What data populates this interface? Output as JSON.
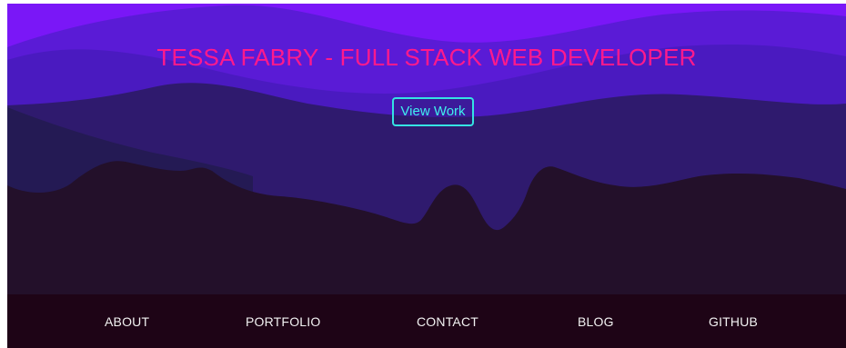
{
  "hero": {
    "title": "TESSA FABRY - FULL STACK WEB DEVELOPER",
    "cta_label": "View Work"
  },
  "nav": {
    "items": [
      {
        "label": "ABOUT"
      },
      {
        "label": "PORTFOLIO"
      },
      {
        "label": "CONTACT"
      },
      {
        "label": "BLOG"
      },
      {
        "label": "GITHUB"
      }
    ]
  },
  "colors": {
    "sky": "#7a17f7",
    "title": "#ff1a8c",
    "button_border": "#35e3e3",
    "nav_background": "#1e0416",
    "nav_text": "#f2f2f2"
  }
}
